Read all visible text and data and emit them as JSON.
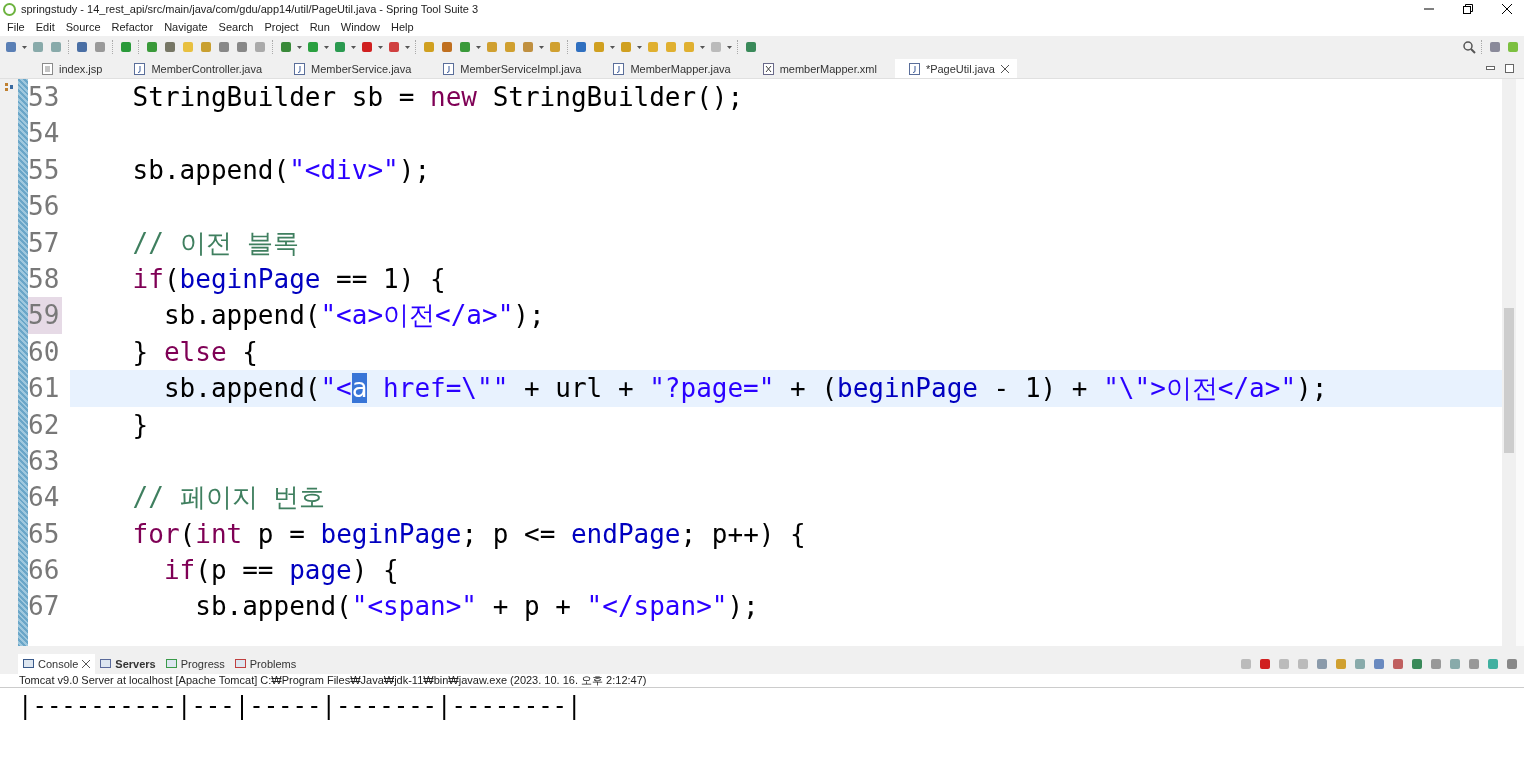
{
  "window": {
    "title": "springstudy - 14_rest_api/src/main/java/com/gdu/app14/util/PageUtil.java - Spring Tool Suite 3"
  },
  "menu": [
    "File",
    "Edit",
    "Source",
    "Refactor",
    "Navigate",
    "Search",
    "Project",
    "Run",
    "Window",
    "Help"
  ],
  "editor_tabs": [
    {
      "label": "index.jsp",
      "kind": "jsp",
      "selected": false,
      "closable": false
    },
    {
      "label": "MemberController.java",
      "kind": "java",
      "selected": false,
      "closable": false
    },
    {
      "label": "MemberService.java",
      "kind": "java",
      "selected": false,
      "closable": false
    },
    {
      "label": "MemberServiceImpl.java",
      "kind": "java",
      "selected": false,
      "closable": false
    },
    {
      "label": "MemberMapper.java",
      "kind": "java",
      "selected": false,
      "closable": false
    },
    {
      "label": "memberMapper.xml",
      "kind": "xml",
      "selected": false,
      "closable": false
    },
    {
      "label": "*PageUtil.java",
      "kind": "java",
      "selected": true,
      "closable": true
    }
  ],
  "editor": {
    "lines": [
      {
        "number": "53",
        "current": false,
        "marked": false,
        "tokens": [
          {
            "kind": "plain",
            "text": "    StringBuilder sb = "
          },
          {
            "kind": "keyword",
            "text": "new"
          },
          {
            "kind": "plain",
            "text": " StringBuilder();"
          }
        ]
      },
      {
        "number": "54",
        "current": false,
        "marked": false
      },
      {
        "number": "55",
        "current": false,
        "marked": false,
        "tokens": [
          {
            "kind": "plain",
            "text": "    sb.append("
          },
          {
            "kind": "string",
            "text": "\"<div>\""
          },
          {
            "kind": "plain",
            "text": ");"
          }
        ]
      },
      {
        "number": "56",
        "current": false,
        "marked": false
      },
      {
        "number": "57",
        "current": false,
        "marked": false,
        "tokens": [
          {
            "kind": "comment",
            "text": "    // 이전 블록"
          }
        ]
      },
      {
        "number": "58",
        "current": false,
        "marked": false,
        "tokens": [
          {
            "kind": "keyword",
            "text": "    if"
          },
          {
            "kind": "plain",
            "text": "("
          },
          {
            "kind": "field",
            "text": "beginPage"
          },
          {
            "kind": "plain",
            "text": " == 1) {"
          }
        ]
      },
      {
        "number": "59",
        "current": false,
        "marked": true,
        "tokens": [
          {
            "kind": "plain",
            "text": "      sb.append("
          },
          {
            "kind": "string",
            "text": "\"<a>이전</a>\""
          },
          {
            "kind": "plain",
            "text": ");"
          }
        ]
      },
      {
        "number": "60",
        "current": false,
        "marked": false,
        "tokens": [
          {
            "kind": "plain",
            "text": "    } "
          },
          {
            "kind": "keyword",
            "text": "else"
          },
          {
            "kind": "plain",
            "text": " {"
          }
        ]
      },
      {
        "number": "61",
        "current": true,
        "marked": false,
        "tokens": [
          {
            "kind": "plain",
            "text": "      sb.append("
          },
          {
            "kind": "string",
            "text": "\"<"
          },
          {
            "kind": "selection",
            "text": "a"
          },
          {
            "kind": "string",
            "text": " href=\\\"\""
          },
          {
            "kind": "plain",
            "text": " + url + "
          },
          {
            "kind": "string",
            "text": "\"?page=\""
          },
          {
            "kind": "plain",
            "text": " + ("
          },
          {
            "kind": "field",
            "text": "beginPage"
          },
          {
            "kind": "plain",
            "text": " - 1) + "
          },
          {
            "kind": "string",
            "text": "\"\\\">이전</a>\""
          },
          {
            "kind": "plain",
            "text": ");"
          }
        ]
      },
      {
        "number": "62",
        "current": false,
        "marked": false,
        "tokens": [
          {
            "kind": "plain",
            "text": "    }"
          }
        ]
      },
      {
        "number": "63",
        "current": false,
        "marked": false
      },
      {
        "number": "64",
        "current": false,
        "marked": false,
        "tokens": [
          {
            "kind": "comment",
            "text": "    // 페이지 번호"
          }
        ]
      },
      {
        "number": "65",
        "current": false,
        "marked": false,
        "tokens": [
          {
            "kind": "keyword",
            "text": "    for"
          },
          {
            "kind": "plain",
            "text": "("
          },
          {
            "kind": "keyword",
            "text": "int"
          },
          {
            "kind": "plain",
            "text": " p = "
          },
          {
            "kind": "field",
            "text": "beginPage"
          },
          {
            "kind": "plain",
            "text": "; p <= "
          },
          {
            "kind": "field",
            "text": "endPage"
          },
          {
            "kind": "plain",
            "text": "; p++) {"
          }
        ]
      },
      {
        "number": "66",
        "current": false,
        "marked": false,
        "tokens": [
          {
            "kind": "keyword",
            "text": "      if"
          },
          {
            "kind": "plain",
            "text": "(p == "
          },
          {
            "kind": "field",
            "text": "page"
          },
          {
            "kind": "plain",
            "text": ") {"
          }
        ]
      },
      {
        "number": "67",
        "current": false,
        "marked": false,
        "tokens": [
          {
            "kind": "plain",
            "text": "        sb.append("
          },
          {
            "kind": "string",
            "text": "\"<span>\""
          },
          {
            "kind": "plain",
            "text": " + p + "
          },
          {
            "kind": "string",
            "text": "\"</span>\""
          },
          {
            "kind": "plain",
            "text": ");"
          }
        ]
      }
    ]
  },
  "bottom_tabs": [
    {
      "label": "Console",
      "selected": true,
      "closable": true,
      "bold": false
    },
    {
      "label": "Servers",
      "selected": false,
      "closable": false,
      "bold": true
    },
    {
      "label": "Progress",
      "selected": false,
      "closable": false,
      "bold": false
    },
    {
      "label": "Problems",
      "selected": false,
      "closable": false,
      "bold": false
    }
  ],
  "console": {
    "description": "Tomcat v9.0 Server at localhost [Apache Tomcat] C:₩Program Files₩Java₩jdk-11₩bin₩javaw.exe  (2023. 10. 16. 오후 2:12:47)",
    "output": "|----------|---|-----|-------|--------|"
  }
}
